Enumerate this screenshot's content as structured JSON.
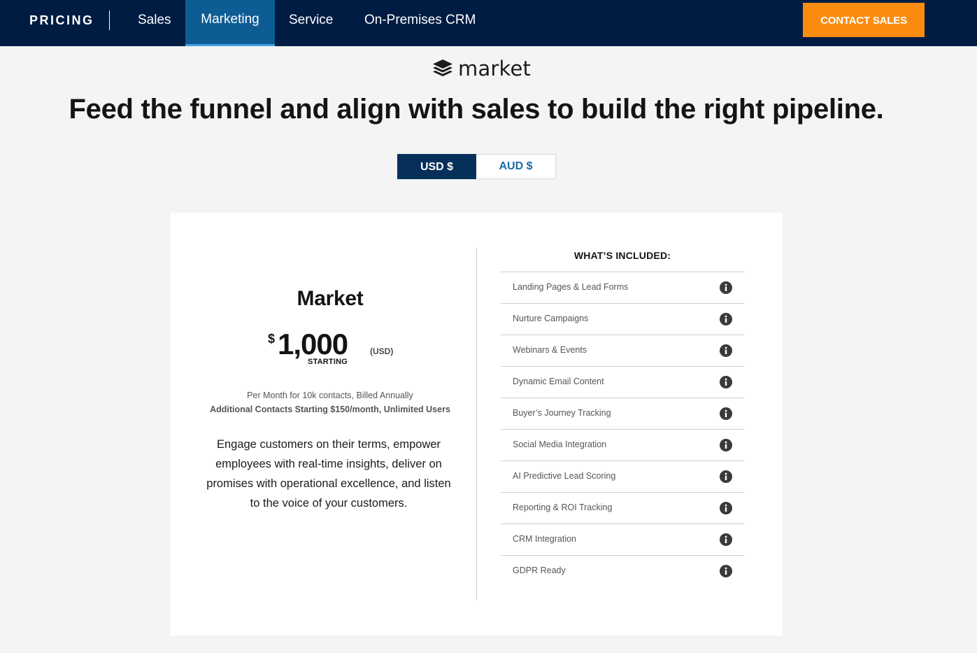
{
  "nav": {
    "brand": "PRICING",
    "items": [
      {
        "label": "Sales",
        "active": false
      },
      {
        "label": "Marketing",
        "active": true
      },
      {
        "label": "Service",
        "active": false
      },
      {
        "label": "On-Premises CRM",
        "active": false
      }
    ],
    "cta_label": "CONTACT SALES"
  },
  "logo": {
    "text": "market",
    "icon": "stacked-layers-icon"
  },
  "headline": "Feed the funnel and align with sales to build the right pipeline.",
  "currency": {
    "options": [
      {
        "label": "USD $",
        "selected": true
      },
      {
        "label": "AUD $",
        "selected": false
      }
    ]
  },
  "plan": {
    "name": "Market",
    "currency_symbol": "$",
    "price": "1,000",
    "price_unit": "(USD)",
    "price_qualifier": "STARTING",
    "billing_line_1": "Per Month for 10k contacts, Billed Annually",
    "billing_line_2": "Additional Contacts Starting $150/month, Unlimited Users",
    "description": "Engage customers on their terms, empower employees with real-time insights, deliver on promises with operational excellence, and listen to the voice of your customers."
  },
  "included": {
    "title": "WHAT’S INCLUDED:",
    "features": [
      "Landing Pages & Lead Forms",
      "Nurture Campaigns",
      "Webinars & Events",
      "Dynamic Email Content",
      "Buyer’s Journey Tracking",
      "Social Media Integration",
      "AI Predictive Lead Scoring",
      "Reporting & ROI Tracking",
      "CRM Integration",
      "GDPR Ready"
    ],
    "feature_icon": "info-icon"
  },
  "colors": {
    "nav_bg": "#001c43",
    "nav_active": "#0d5c94",
    "cta": "#f98c0f",
    "toggle_selected": "#06305a",
    "toggle_text": "#1a6ea8",
    "page_bg": "#f3f4f3"
  }
}
